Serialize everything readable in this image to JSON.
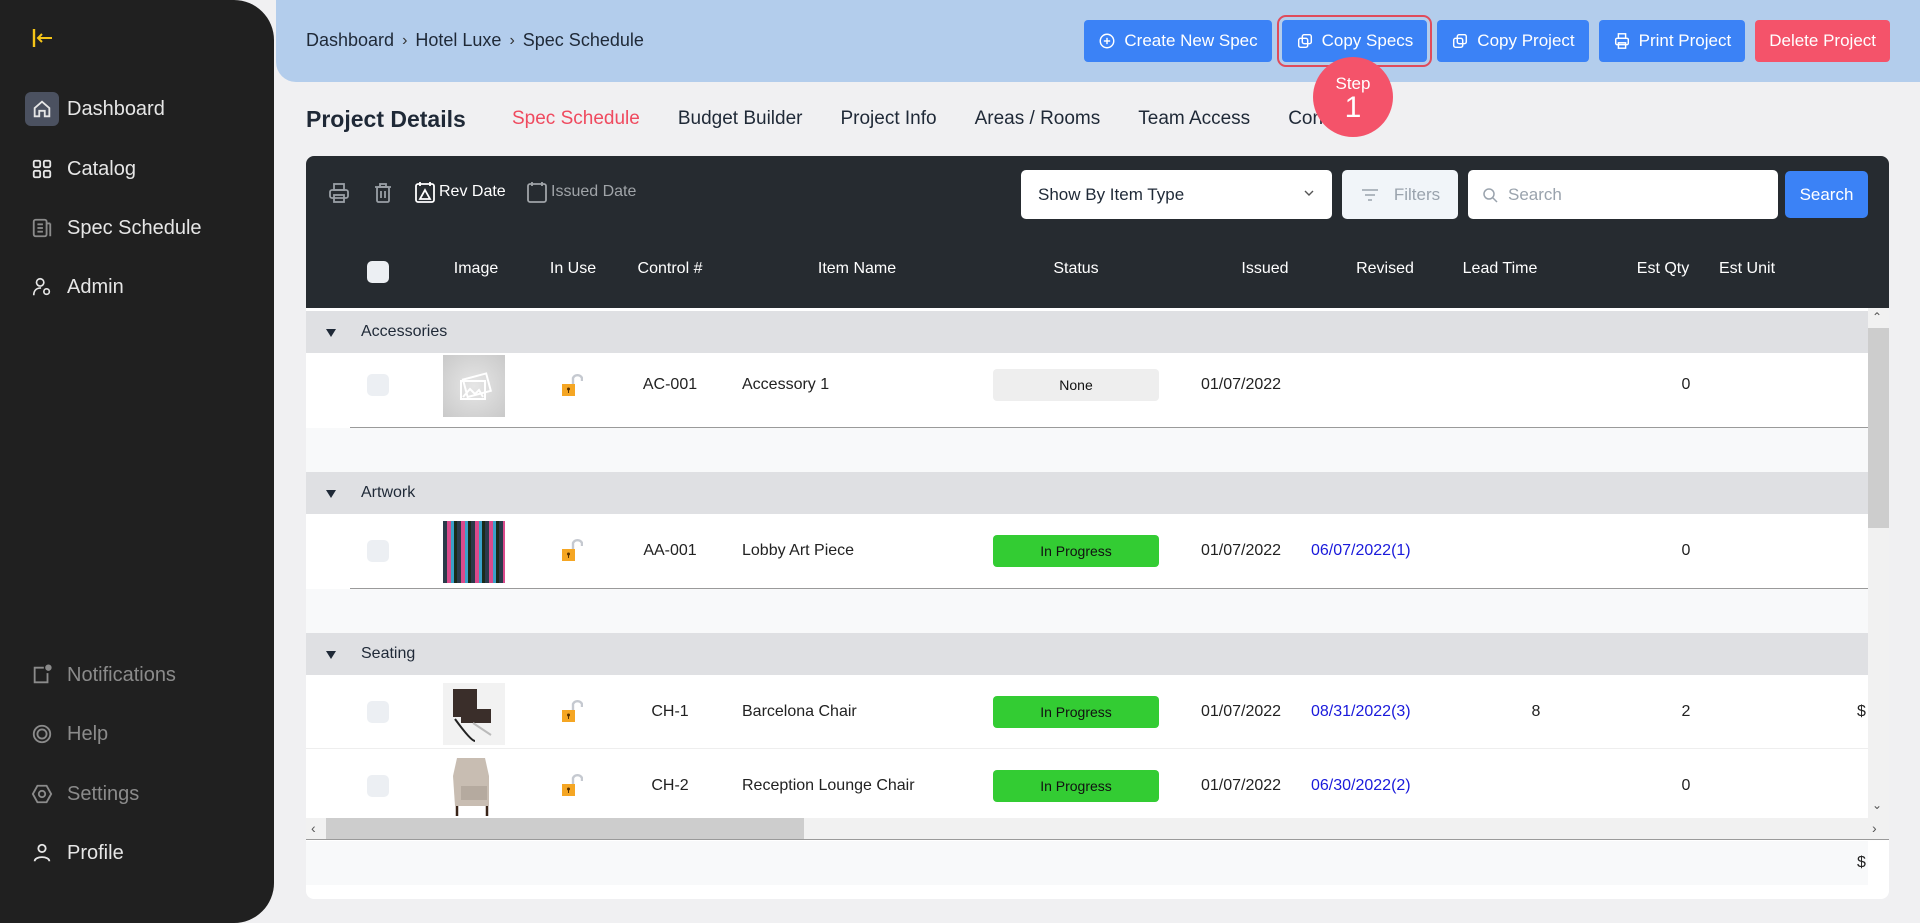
{
  "sidebar": {
    "logo_icon": "collapse-arrow-icon",
    "top_items": [
      {
        "label": "Dashboard",
        "icon": "home-icon",
        "active": true
      },
      {
        "label": "Catalog",
        "icon": "grid-icon"
      },
      {
        "label": "Spec Schedule",
        "icon": "document-icon"
      },
      {
        "label": "Admin",
        "icon": "user-gear-icon"
      }
    ],
    "bottom_items": [
      {
        "label": "Notifications",
        "icon": "notification-icon"
      },
      {
        "label": "Help",
        "icon": "lifebuoy-icon"
      },
      {
        "label": "Settings",
        "icon": "settings-icon"
      },
      {
        "label": "Profile",
        "icon": "user-icon"
      }
    ]
  },
  "header": {
    "breadcrumb": [
      "Dashboard",
      "Hotel Luxe",
      "Spec Schedule"
    ],
    "buttons": {
      "create_new_spec": "Create New Spec",
      "copy_specs": "Copy Specs",
      "copy_project": "Copy Project",
      "print_project": "Print Project",
      "delete_project": "Delete Project"
    }
  },
  "step_badge": {
    "label": "Step",
    "number": "1"
  },
  "page": {
    "title": "Project Details",
    "tabs": [
      "Spec Schedule",
      "Budget Builder",
      "Project Info",
      "Areas / Rooms",
      "Team Access",
      "Config"
    ],
    "active_tab": "Spec Schedule"
  },
  "toolbar": {
    "rev_date": "Rev Date",
    "issued_date": "Issued Date",
    "group_select": "Show By Item Type",
    "filters": "Filters",
    "search_placeholder": "Search",
    "search_button": "Search"
  },
  "table": {
    "columns": [
      "Image",
      "In Use",
      "Control #",
      "Item Name",
      "Status",
      "Issued",
      "Revised",
      "Lead Time",
      "Est Qty",
      "Est Unit"
    ],
    "groups": [
      {
        "name": "Accessories",
        "rows": [
          {
            "control": "AC-001",
            "name": "Accessory 1",
            "status": "None",
            "issued": "01/07/2022",
            "revised": "",
            "lead_time": "",
            "est_qty": "0",
            "est_unit": ""
          }
        ]
      },
      {
        "name": "Artwork",
        "rows": [
          {
            "control": "AA-001",
            "name": "Lobby Art Piece",
            "status": "In Progress",
            "issued": "01/07/2022",
            "revised": "06/07/2022(1)",
            "lead_time": "",
            "est_qty": "0",
            "est_unit": ""
          }
        ]
      },
      {
        "name": "Seating",
        "rows": [
          {
            "control": "CH-1",
            "name": "Barcelona Chair",
            "status": "In Progress",
            "issued": "01/07/2022",
            "revised": "08/31/2022(3)",
            "lead_time": "8",
            "est_qty": "2",
            "est_unit": "$"
          },
          {
            "control": "CH-2",
            "name": "Reception Lounge Chair",
            "status": "In Progress",
            "issued": "01/07/2022",
            "revised": "06/30/2022(2)",
            "lead_time": "",
            "est_qty": "0",
            "est_unit": ""
          }
        ]
      }
    ],
    "footer_total": "$"
  },
  "colors": {
    "accent_blue": "#3b82f6",
    "danger_red": "#f4536a",
    "status_in_progress": "#33cc33",
    "status_none": "#eeeeee",
    "revised_link": "#1a1adb",
    "active_tab": "#ef4a5f"
  }
}
